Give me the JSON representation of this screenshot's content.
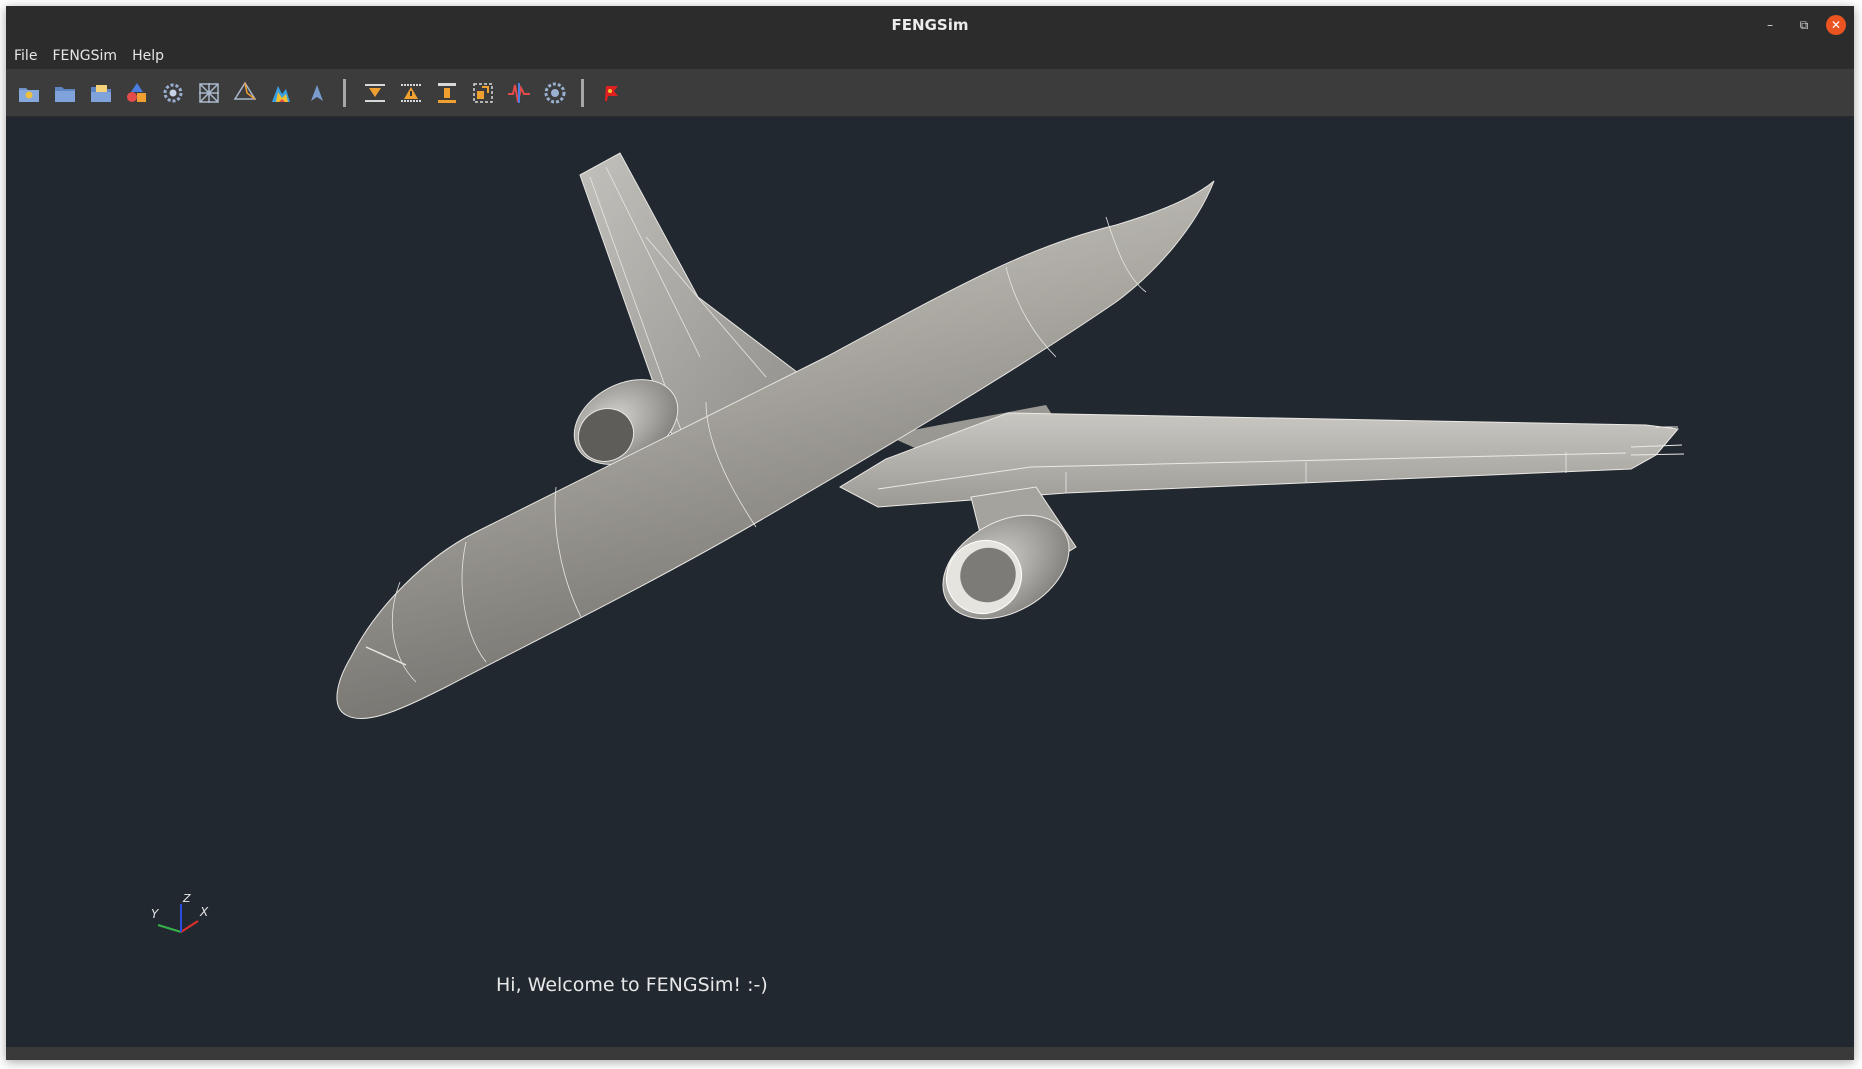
{
  "window": {
    "title": "FENGSim",
    "controls": {
      "minimize": "–",
      "maximize": "⧉",
      "close": "✕"
    }
  },
  "menu": [
    {
      "label": "File"
    },
    {
      "label": "FENGSim"
    },
    {
      "label": "Help"
    }
  ],
  "toolbar": {
    "groups": [
      [
        "new-project-icon",
        "open-folder-icon",
        "open-file-icon",
        "geometry-shapes-icon",
        "cad-gear-icon",
        "mesh-icon",
        "tetrahedron-icon",
        "colormap-icon",
        "arrow-marker-icon"
      ],
      [
        "layer-filter-icon",
        "layer-warning-icon",
        "layer-stack-icon",
        "transform-icon",
        "waveform-icon",
        "atom-gear-icon"
      ],
      [
        "flag-icon"
      ]
    ]
  },
  "viewport": {
    "background": "#212830",
    "model_color": "#b9b7b2",
    "axes": {
      "x": "X",
      "y": "Y",
      "z": "Z",
      "x_color": "#e0302a",
      "y_color": "#36b24a",
      "z_color": "#2a4ee0"
    },
    "welcome_text": "Hi, Welcome to FENGSim! :-)"
  }
}
